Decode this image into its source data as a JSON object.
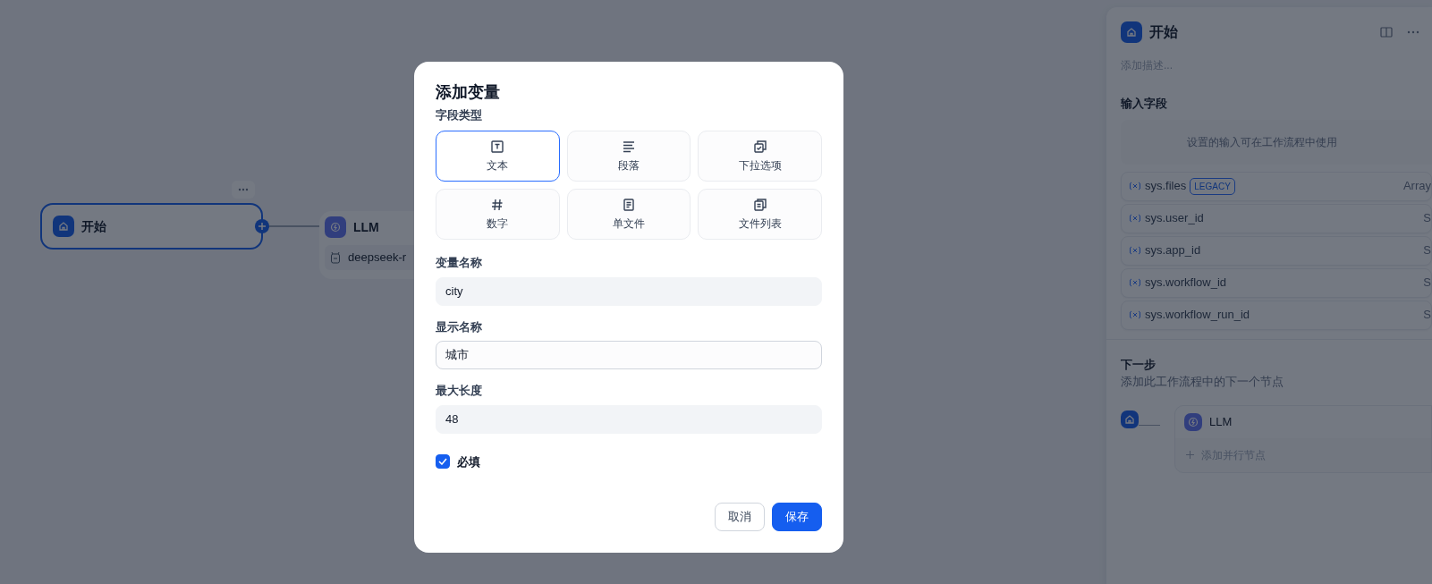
{
  "canvas": {
    "start_node": {
      "title": "开始",
      "selected": true
    },
    "llm_node": {
      "title": "LLM",
      "model": "deepseek-r"
    }
  },
  "modal": {
    "title": "添加变量",
    "field_type_label": "字段类型",
    "field_types": [
      {
        "kind": "text",
        "label": "文本",
        "selected": true
      },
      {
        "kind": "paragraph",
        "label": "段落",
        "selected": false
      },
      {
        "kind": "select",
        "label": "下拉选项",
        "selected": false
      },
      {
        "kind": "number",
        "label": "数字",
        "selected": false
      },
      {
        "kind": "file",
        "label": "单文件",
        "selected": false
      },
      {
        "kind": "file-list",
        "label": "文件列表",
        "selected": false
      }
    ],
    "fields": [
      {
        "label": "变量名称",
        "value": "city",
        "focused": false
      },
      {
        "label": "显示名称",
        "value": "城市",
        "focused": true
      },
      {
        "label": "最大长度",
        "value": "48",
        "focused": false
      }
    ],
    "required": {
      "label": "必填",
      "checked": true
    },
    "buttons": {
      "cancel": "取消",
      "save": "保存"
    }
  },
  "panel": {
    "title": "开始",
    "description": {
      "placeholder": "添加描述..."
    },
    "input_section": "输入字段",
    "input_empty": "设置的输入可在工作流程中使用",
    "variables": [
      {
        "name": "sys.files",
        "badge": "LEGACY",
        "type": "Array"
      },
      {
        "name": "sys.user_id",
        "type": "S"
      },
      {
        "name": "sys.app_id",
        "type": "S"
      },
      {
        "name": "sys.workflow_id",
        "type": "S"
      },
      {
        "name": "sys.workflow_run_id",
        "type": "S"
      }
    ],
    "next_step": {
      "title": "下一步",
      "subtitle": "添加此工作流程中的下一个节点",
      "node": "LLM",
      "add_parallel": "添加并行节点"
    }
  }
}
